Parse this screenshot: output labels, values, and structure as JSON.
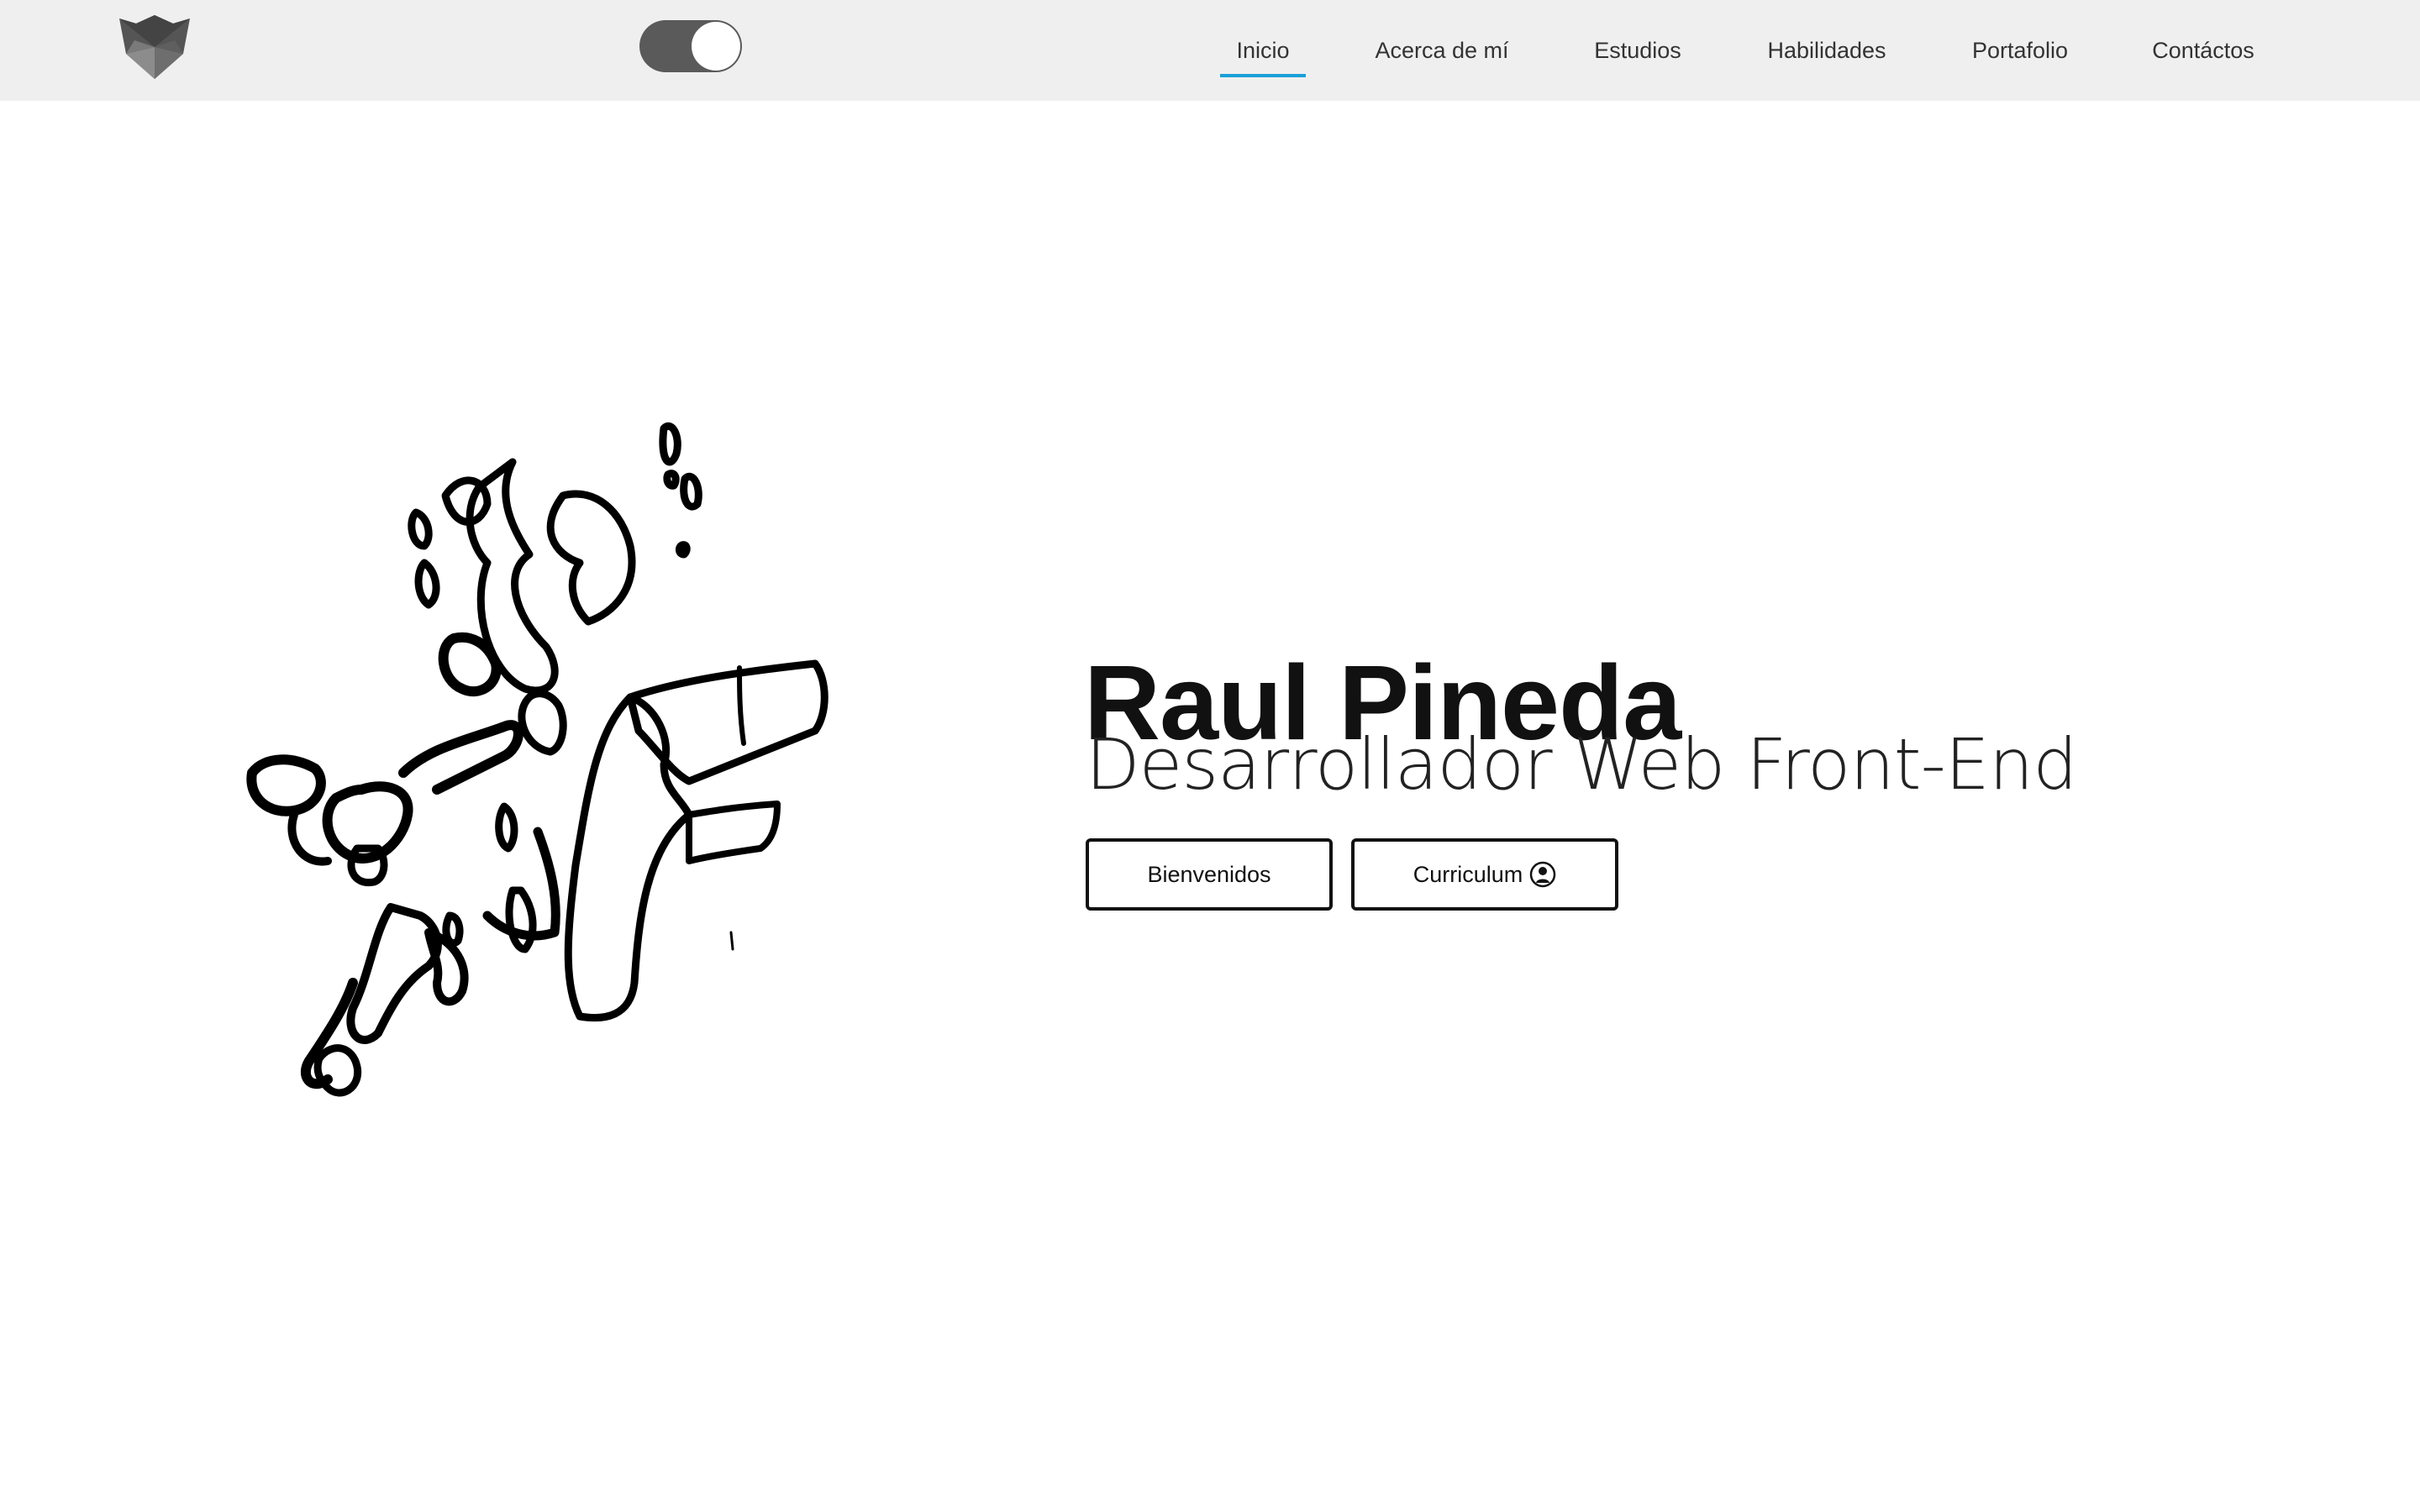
{
  "header": {
    "logo_icon": "fox-head-logo-icon",
    "theme_toggle": {
      "state": "on"
    },
    "nav": [
      {
        "label": "Inicio",
        "active": true
      },
      {
        "label": "Acerca de mí",
        "active": false
      },
      {
        "label": "Estudios",
        "active": false
      },
      {
        "label": "Habilidades",
        "active": false
      },
      {
        "label": "Portafolio",
        "active": false
      },
      {
        "label": "Contáctos",
        "active": false
      }
    ],
    "accent_color": "#1aa0d8"
  },
  "hero": {
    "illustration_icon": "ink-splash-figure-illustration",
    "name": "Raul Pineda",
    "role": "Desarrollador Web Front-End",
    "buttons": {
      "welcome_label": "Bienvenidos",
      "cv_label": "Curriculum",
      "cv_icon": "user-circle-icon"
    }
  }
}
